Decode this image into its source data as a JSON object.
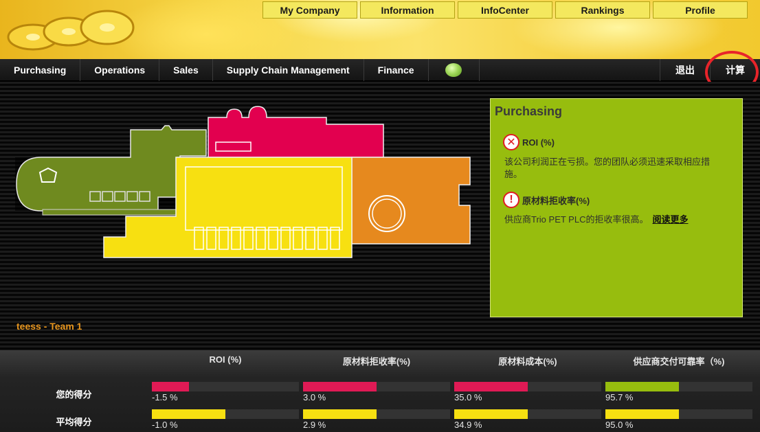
{
  "topnav": [
    "My Company",
    "Information",
    "InfoCenter",
    "Rankings",
    "Profile"
  ],
  "menu": [
    "Purchasing",
    "Operations",
    "Sales",
    "Supply Chain Management",
    "Finance"
  ],
  "menu_right": {
    "logout": "退出",
    "calculate": "计算"
  },
  "team_label": "teess - Team 1",
  "panel": {
    "title": "Purchasing",
    "items": [
      {
        "icon": "x-error-icon",
        "label": "ROI (%)",
        "text": "该公司利润正在亏损。您的团队必须迅速采取相应措施。",
        "link": ""
      },
      {
        "icon": "exclamation-warning-icon",
        "label": "原材料拒收率(%)",
        "text": "供应商Trio PET PLC的拒收率很高。",
        "link": "阅读更多"
      }
    ]
  },
  "scores": {
    "columns": [
      "ROI (%)",
      "原材料拒收率(%)",
      "原材料成本(%)",
      "供应商交付可靠率（%)"
    ],
    "rows": [
      {
        "label": "您的得分",
        "values": [
          "-1.5 %",
          "3.0 %",
          "35.0 %",
          "95.7 %"
        ],
        "fill": [
          0.25,
          0.5,
          0.5,
          0.5
        ],
        "colors": [
          "#e01a55",
          "#e01a55",
          "#e01a55",
          "#97bd0e"
        ]
      },
      {
        "label": "平均得分",
        "values": [
          "-1.0 %",
          "2.9 %",
          "34.9 %",
          "95.0 %"
        ],
        "fill": [
          0.5,
          0.5,
          0.5,
          0.5
        ],
        "colors": [
          "#f7e011",
          "#f7e011",
          "#f7e011",
          "#f7e011"
        ]
      }
    ]
  },
  "colors": {
    "accent_yellow": "#f7e011",
    "accent_red": "#e01a55",
    "accent_green": "#97bd0e",
    "accent_orange": "#e6891e",
    "olive": "#6f8a1f"
  }
}
